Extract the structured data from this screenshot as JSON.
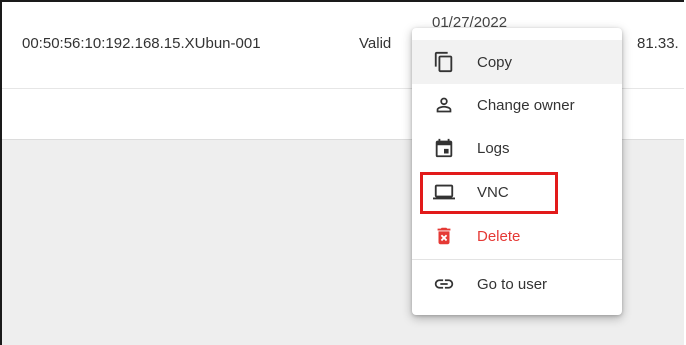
{
  "table_row": {
    "mac_name": "00:50:56:10:192.168.15.XUbun-001",
    "status": "Valid",
    "date": "01/27/2022",
    "ip": "81.33."
  },
  "context_menu": {
    "items": [
      {
        "label": "Copy",
        "icon": "copy-icon"
      },
      {
        "label": "Change owner",
        "icon": "person-icon"
      },
      {
        "label": "Logs",
        "icon": "calendar-icon"
      },
      {
        "label": "VNC",
        "icon": "laptop-icon"
      },
      {
        "label": "Delete",
        "icon": "delete-icon"
      },
      {
        "label": "Go to user",
        "icon": "link-icon"
      }
    ]
  },
  "colors": {
    "danger": "#e53935",
    "highlight": "#e21a1a",
    "hover_bg": "#f2f2f2"
  }
}
